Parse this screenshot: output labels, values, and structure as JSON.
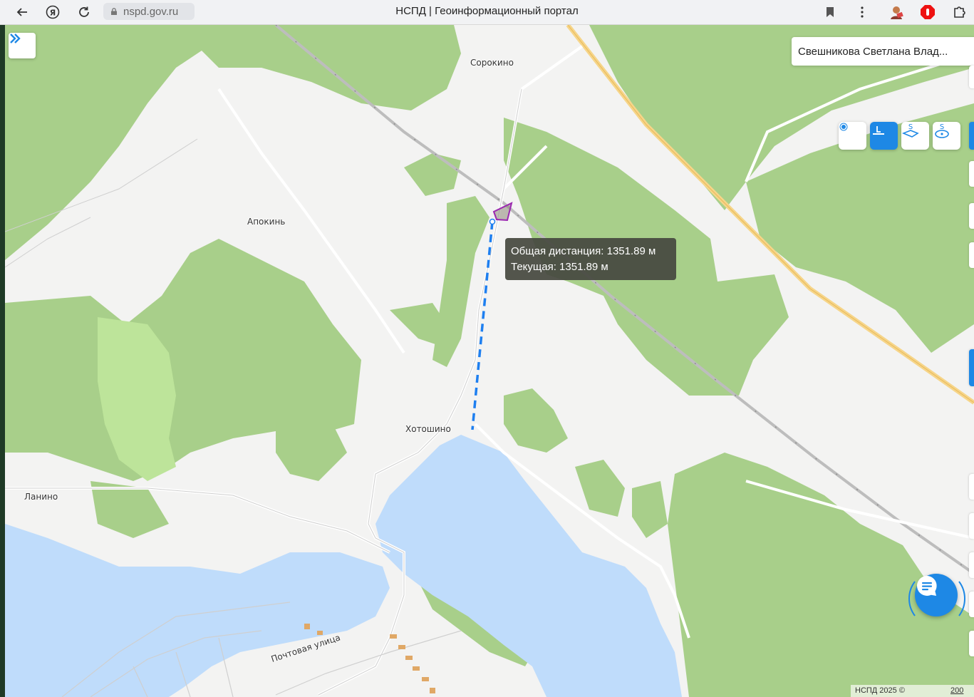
{
  "browser": {
    "url": "nspd.gov.ru",
    "page_title": "НСПД | Геоинформационный портал",
    "back_icon": "arrow-left-icon",
    "yandex_icon": "yandex-icon",
    "reload_icon": "reload-icon",
    "bookmark_icon": "bookmark-icon",
    "menu_icon": "more-vertical-icon",
    "extensions": [
      "extension-avatar-icon",
      "adblock-extension-icon",
      "extensions-puzzle-icon"
    ]
  },
  "map": {
    "places": {
      "sorokino": "Сорокино",
      "apokin": "Апокинь",
      "khotoshino": "Хотошино",
      "lanino": "Ланино",
      "pochtovaya": "Почтовая  улица"
    },
    "colors": {
      "forest": "#a8cf8a",
      "forest_light": "#bde49a",
      "water": "#bfdcfb",
      "background": "#f3f3f2",
      "highway": "#f6d589",
      "measure_line": "#1e7ff0",
      "parcel_outline": "#9b27b0"
    }
  },
  "user": {
    "name": "Свешникова Светлана Влад..."
  },
  "tools": [
    {
      "name": "point-measure-icon",
      "active": false
    },
    {
      "name": "line-measure-icon",
      "active": true
    },
    {
      "name": "area-measure-icon",
      "active": false
    },
    {
      "name": "circle-area-measure-icon",
      "active": false
    }
  ],
  "measurement": {
    "total_label": "Общая дистанция:",
    "total_value": "1351.89 м",
    "current_label": "Текущая:",
    "current_value": "1351.89 м"
  },
  "chat": {
    "icon": "chat-icon"
  },
  "footer": {
    "credit": "НСПД 2025 ©",
    "scale": "200"
  }
}
